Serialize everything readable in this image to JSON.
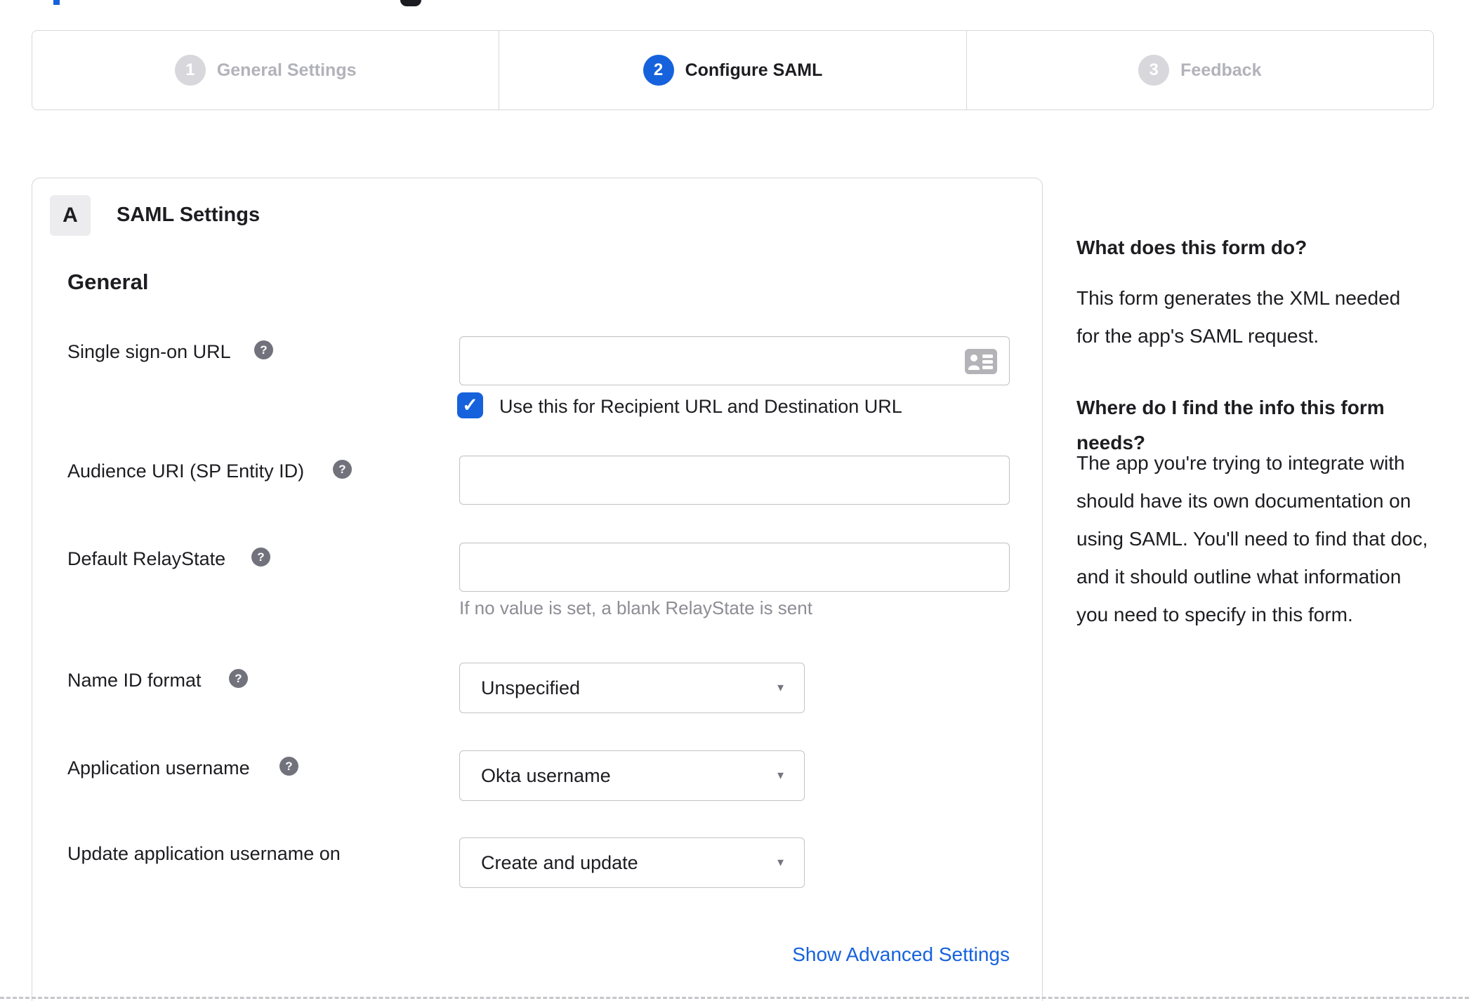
{
  "stepper": {
    "steps": [
      {
        "number": "1",
        "label": "General Settings",
        "state": "inactive"
      },
      {
        "number": "2",
        "label": "Configure SAML",
        "state": "active"
      },
      {
        "number": "3",
        "label": "Feedback",
        "state": "inactive"
      }
    ]
  },
  "panel": {
    "badge": "A",
    "title": "SAML Settings",
    "section_heading": "General",
    "fields": {
      "sso": {
        "label": "Single sign-on URL",
        "value": "",
        "checkbox_label": "Use this for Recipient URL and Destination URL",
        "checked": true
      },
      "audience": {
        "label": "Audience URI (SP Entity ID)",
        "value": ""
      },
      "relay": {
        "label": "Default RelayState",
        "value": "",
        "hint": "If no value is set, a blank RelayState is sent"
      },
      "name_id": {
        "label": "Name ID format",
        "value": "Unspecified"
      },
      "app_username": {
        "label": "Application username",
        "value": "Okta username"
      },
      "update_username": {
        "label": "Update application username on",
        "value": "Create and update"
      }
    },
    "advanced_link": "Show Advanced Settings"
  },
  "sidebar": {
    "heading1": "What does this form do?",
    "para1": "This form generates the XML needed for the app's SAML request.",
    "heading2": "Where do I find the info this form needs?",
    "para2": "The app you're trying to integrate with should have its own documentation on using SAML. You'll need to find that doc, and it should outline what information you need to specify in this form."
  },
  "icons": {
    "help_glyph": "?",
    "check_glyph": "✓",
    "caret_glyph": "▼"
  },
  "colors": {
    "accent_blue": "#1662dd",
    "text_dark": "#1d1d21",
    "muted_gray": "#8d8d95",
    "inactive_gray": "#b2b2ba",
    "border_gray": "#d7d7dc"
  }
}
